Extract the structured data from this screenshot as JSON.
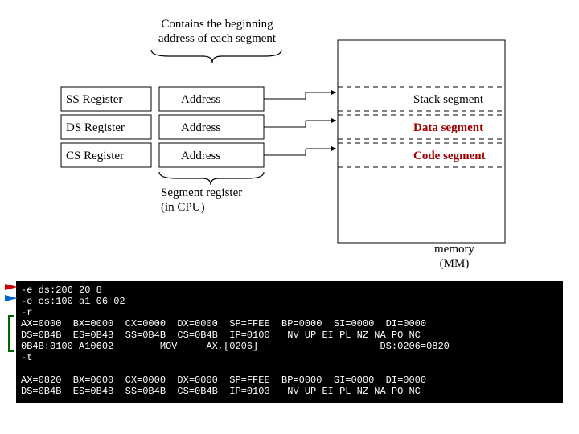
{
  "header": {
    "line1": "Contains the beginning",
    "line2": "address of each segment"
  },
  "rows": [
    {
      "reg": "SS Register",
      "addr": "Address",
      "seg": "Stack segment"
    },
    {
      "reg": "DS Register",
      "addr": "Address",
      "seg": "Data segment"
    },
    {
      "reg": "CS Register",
      "addr": "Address",
      "seg": "Code segment"
    }
  ],
  "sub": {
    "line1": "Segment register",
    "line2": "(in CPU)"
  },
  "memory": {
    "line1": "memory",
    "line2": "(MM)"
  },
  "console": {
    "lines": [
      "-e ds:206 20 8",
      "-e cs:100 a1 06 02",
      "-r",
      "AX=0000  BX=0000  CX=0000  DX=0000  SP=FFEE  BP=0000  SI=0000  DI=0000",
      "DS=0B4B  ES=0B4B  SS=0B4B  CS=0B4B  IP=0100   NV UP EI PL NZ NA PO NC",
      "0B4B:0100 A10602        MOV     AX,[0206]                     DS:0206=0820",
      "-t",
      "",
      "AX=0820  BX=0000  CX=0000  DX=0000  SP=FFEE  BP=0000  SI=0000  DI=0000",
      "DS=0B4B  ES=0B4B  SS=0B4B  CS=0B4B  IP=0103   NV UP EI PL NZ NA PO NC"
    ]
  }
}
